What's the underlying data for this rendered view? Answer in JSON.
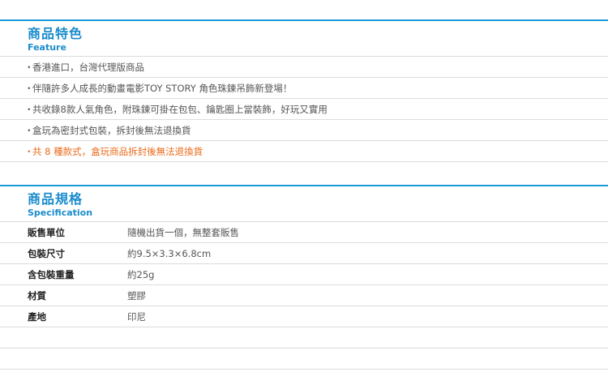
{
  "feature": {
    "title_zh": "商品特色",
    "title_en": "Feature",
    "bullet": "・",
    "items": [
      {
        "text": "香港進口，台灣代理版商品",
        "highlight": false
      },
      {
        "text": "伴隨許多人成長的動畫電影TOY STORY 角色珠鍊吊飾新登場！",
        "highlight": false
      },
      {
        "text": "共收錄8款人氣角色，附珠鍊可掛在包包、鑰匙圈上當裝飾，好玩又實用",
        "highlight": false
      },
      {
        "text": "盒玩為密封式包裝，拆封後無法退換貨",
        "highlight": false
      },
      {
        "text": "共 8 種款式，盒玩商品拆封後無法退換貨",
        "highlight": true
      }
    ],
    "accent_color": "#1a8ccc",
    "highlight_color": "#ea6a1a"
  },
  "spec": {
    "title_zh": "商品規格",
    "title_en": "Specification",
    "rows": [
      {
        "label": "販售單位",
        "value": "隨機出貨一個，無整套販售"
      },
      {
        "label": "包裝尺寸",
        "value": "約9.5×3.3×6.8cm"
      },
      {
        "label": "含包裝重量",
        "value": "約25g"
      },
      {
        "label": "材質",
        "value": "塑膠"
      },
      {
        "label": "產地",
        "value": "印尼"
      }
    ]
  }
}
